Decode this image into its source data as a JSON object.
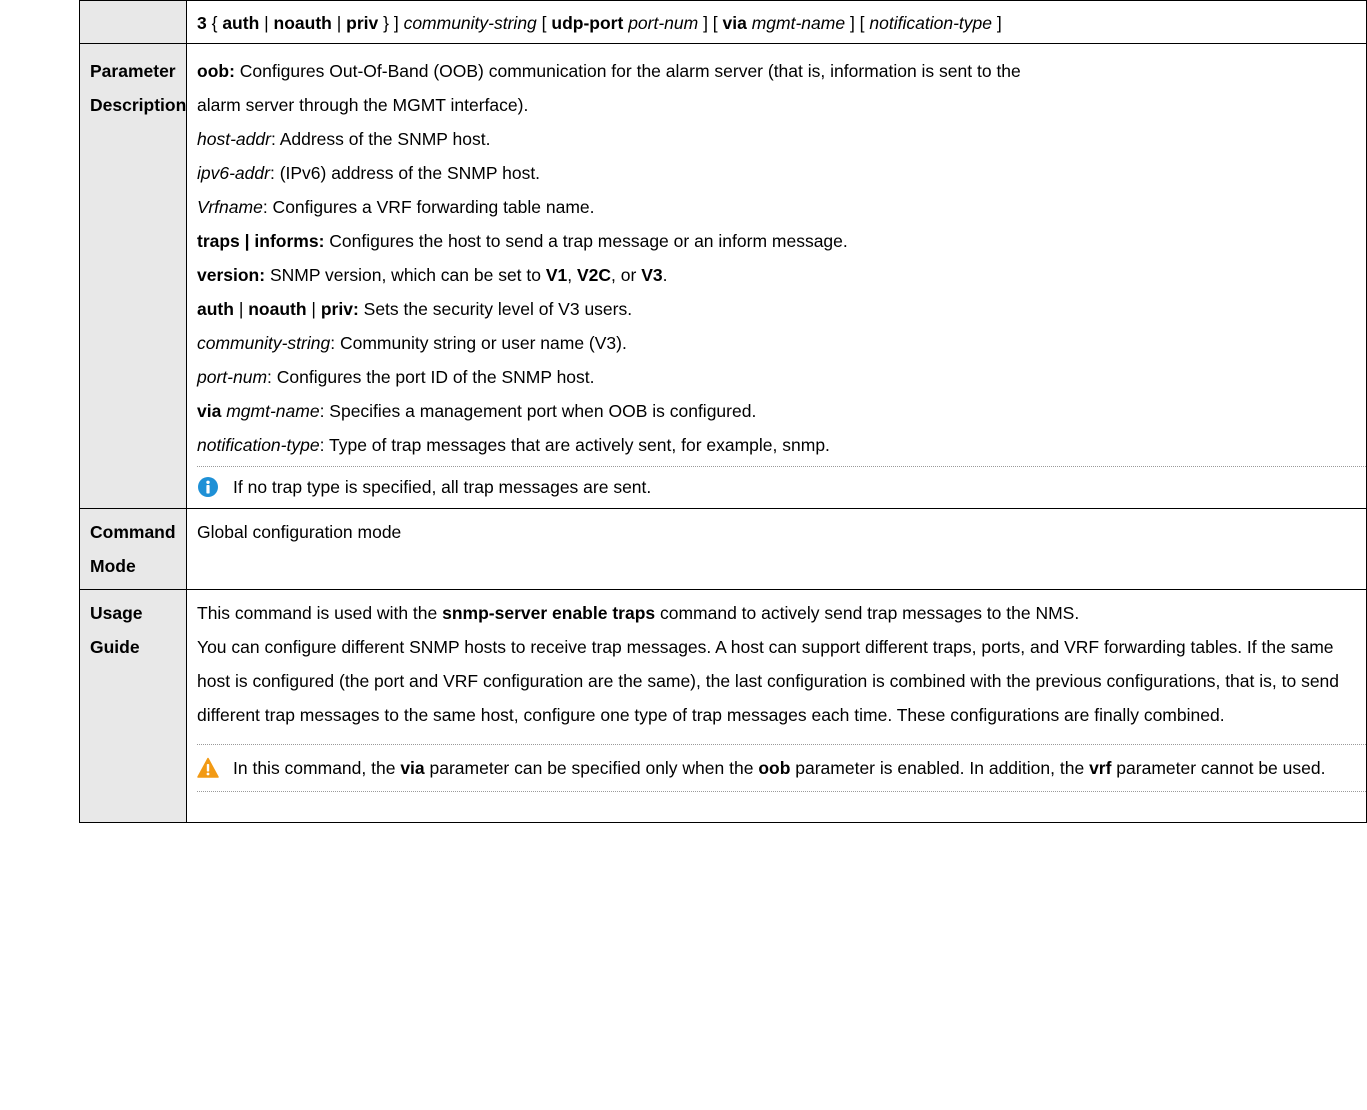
{
  "syntax_tail": [
    {
      "t": "3",
      "s": "b"
    },
    {
      "t": " { "
    },
    {
      "t": "auth",
      "s": "b"
    },
    {
      "t": " | "
    },
    {
      "t": "noauth",
      "s": "b"
    },
    {
      "t": " | "
    },
    {
      "t": "priv",
      "s": "b"
    },
    {
      "t": " } ] "
    },
    {
      "t": "community-string",
      "s": "i"
    },
    {
      "t": " [ "
    },
    {
      "t": "udp-port",
      "s": "b"
    },
    {
      "t": " "
    },
    {
      "t": "port-num",
      "s": "i"
    },
    {
      "t": " ] [ "
    },
    {
      "t": "via",
      "s": "b"
    },
    {
      "t": " "
    },
    {
      "t": "mgmt-name",
      "s": "i"
    },
    {
      "t": " ] [ "
    },
    {
      "t": "notification-type",
      "s": "i"
    },
    {
      "t": " ]"
    }
  ],
  "parameter": {
    "label_line1": "Parameter",
    "label_line2": "Description",
    "lines": [
      [
        {
          "t": "oob:",
          "s": "b"
        },
        {
          "t": " Configures Out-Of-Band (OOB) communication for the alarm server (that is, information is sent to the"
        }
      ],
      [
        {
          "t": "alarm server through the MGMT interface)."
        }
      ],
      [
        {
          "t": "host-addr",
          "s": "i"
        },
        {
          "t": ": Address of the SNMP host."
        }
      ],
      [
        {
          "t": "ipv6-addr",
          "s": "i"
        },
        {
          "t": ": (IPv6) address of the SNMP host."
        }
      ],
      [
        {
          "t": "Vrfname",
          "s": "i"
        },
        {
          "t": ": Configures a VRF forwarding table name."
        }
      ],
      [
        {
          "t": "traps | informs:",
          "s": "b"
        },
        {
          "t": " Configures the host to send a trap message or an inform message."
        }
      ],
      [
        {
          "t": "version:",
          "s": "b"
        },
        {
          "t": " SNMP version, which can be set to "
        },
        {
          "t": "V1",
          "s": "b"
        },
        {
          "t": ", "
        },
        {
          "t": "V2C",
          "s": "b"
        },
        {
          "t": ", or "
        },
        {
          "t": "V3",
          "s": "b"
        },
        {
          "t": "."
        }
      ],
      [
        {
          "t": "auth",
          "s": "b"
        },
        {
          "t": " | "
        },
        {
          "t": "noauth",
          "s": "b"
        },
        {
          "t": " | "
        },
        {
          "t": "priv:",
          "s": "b"
        },
        {
          "t": " Sets the security level of V3 users."
        }
      ],
      [
        {
          "t": "community-string",
          "s": "i"
        },
        {
          "t": ": Community string or user name (V3)."
        }
      ],
      [
        {
          "t": "port-num",
          "s": "i"
        },
        {
          "t": ": Configures the port ID of the SNMP host."
        }
      ],
      [
        {
          "t": "via",
          "s": "b"
        },
        {
          "t": " "
        },
        {
          "t": "mgmt-name",
          "s": "i"
        },
        {
          "t": ": Specifies a management port when OOB is configured."
        }
      ],
      [
        {
          "t": "notification-type",
          "s": "i"
        },
        {
          "t": ": Type of trap messages that are actively sent, for example, snmp."
        }
      ]
    ],
    "note_icon": "info-icon",
    "note": [
      {
        "t": "If no trap type is specified, all trap messages are sent."
      }
    ]
  },
  "command_mode": {
    "label_line1": "Command",
    "label_line2": "Mode",
    "value": "Global configuration mode"
  },
  "usage_guide": {
    "label": "Usage Guide",
    "para1": [
      {
        "t": "This command is used with the "
      },
      {
        "t": "snmp-server enable traps",
        "s": "b"
      },
      {
        "t": " command to actively send trap messages to the NMS."
      }
    ],
    "para2": "You can configure different SNMP hosts to receive trap messages. A host can support different traps, ports, and VRF forwarding tables. If the same host is configured (the port and VRF configuration are the same), the last configuration is combined with the previous configurations, that is, to send different trap messages to the same host, configure one type of trap messages each time. These configurations are finally combined.",
    "caution_icon": "warning-icon",
    "caution": [
      {
        "t": "In this command, the "
      },
      {
        "t": "via",
        "s": "b"
      },
      {
        "t": " parameter can be specified only when the "
      },
      {
        "t": "oob",
        "s": "b"
      },
      {
        "t": " parameter is enabled. In addition, the "
      },
      {
        "t": "vrf",
        "s": "b"
      },
      {
        "t": " parameter cannot be used."
      }
    ]
  },
  "colors": {
    "label_bg": "#e8e8e8",
    "info_icon": "#1e90d6",
    "warning_icon": "#f29a14"
  }
}
